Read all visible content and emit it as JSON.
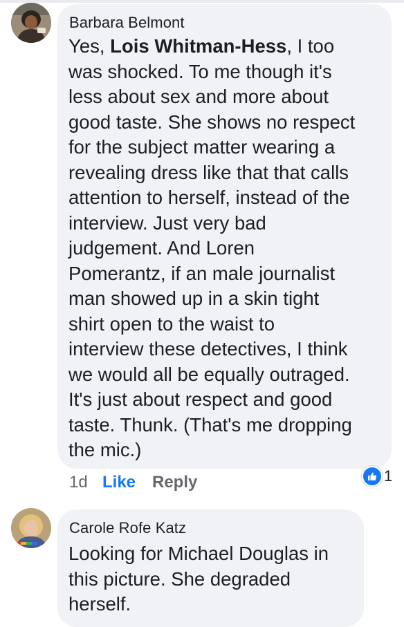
{
  "comments": [
    {
      "author": "Barbara Belmont",
      "body_intro": "Yes, ",
      "mention": "Lois Whitman-Hess",
      "body_rest": ", I too\nwas shocked. To me though it's\nless about sex and more about\ngood taste. She shows no respect\nfor the subject matter wearing a\nrevealing dress like that  that calls\nattention to herself, instead of the\ninterview. Just very bad\njudgement. And Loren\nPomerantz, if an male journalist\nman showed up in a skin tight\nshirt open to the waist to\ninterview these detectives, I think\nwe would all be equally outraged.\nIt's just about respect and good\ntaste. Thunk. (That's me dropping\nthe mic.)",
      "time": "1d",
      "like_label": "Like",
      "reply_label": "Reply",
      "reaction_count": "1"
    },
    {
      "author": "Carole Rofe Katz",
      "body": "Looking for Michael Douglas in\nthis picture. She degraded\nherself."
    }
  ],
  "colors": {
    "bubble": "#f0f2f5",
    "link_blue": "#1877f2",
    "meta_gray": "#65676b",
    "text": "#1c1e21"
  }
}
